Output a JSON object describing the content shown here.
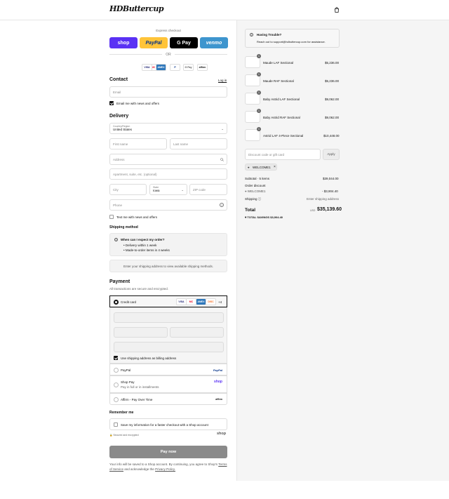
{
  "header": {
    "logo": "HDButtercup"
  },
  "express": {
    "label": "Express checkout",
    "or": "OR",
    "buttons": [
      {
        "label": "shop",
        "bg": "#5a31f4",
        "color": "#fff"
      },
      {
        "label": "PayPal",
        "bg": "#ffc439",
        "color": "#003087"
      },
      {
        "label": "G Pay",
        "bg": "#000",
        "color": "#fff"
      },
      {
        "label": "venmo",
        "bg": "#3d95ce",
        "color": "#fff"
      }
    ],
    "methods": [
      "MC",
      "VISA",
      "AMEX",
      "P",
      "G Pay",
      "affirm"
    ]
  },
  "contact": {
    "title": "Contact",
    "login": "Log in",
    "email_placeholder": "Email",
    "news": "Email me with news and offers"
  },
  "delivery": {
    "title": "Delivery",
    "country_label": "Country/Region",
    "country": "United States",
    "first": "First name",
    "last": "Last name",
    "address": "Address",
    "apt": "Apartment, suite, etc. (optional)",
    "city": "City",
    "state_label": "State",
    "state": "Iowa",
    "zip": "ZIP code",
    "phone": "Phone",
    "text_news": "Text me with news and offers"
  },
  "shipping": {
    "title": "Shipping method",
    "q": "When can I expect my order?",
    "bullets": [
      "Delivery within 1 week",
      "Made-to-order items in 4 weeks"
    ],
    "note": "Enter your shipping address to view available shipping methods."
  },
  "payment": {
    "title": "Payment",
    "sub": "All transactions are secure and encrypted.",
    "credit": "Credit card",
    "cards": [
      "VISA",
      "MC",
      "AMEX",
      "DISC",
      "+4"
    ],
    "billing": "Use shipping address as billing address",
    "paypal": "PayPal",
    "paypal_logo": "PayPal",
    "shoppay": "Shop Pay",
    "shoppay_sub": "Pay in full or in installments",
    "shoppay_logo": "shop",
    "affirm": "Affirm - Pay Over Time",
    "affirm_logo": "affirm"
  },
  "remember": {
    "title": "Remember me",
    "save": "Save my information for a faster checkout with a Shop account",
    "secure": "Secured and encrypted",
    "shop": "shop"
  },
  "paynow": "Pay now",
  "legal": {
    "text": "Your info will be saved to a Shop account. By continuing, you agree to Shop's",
    "tos": "Terms of Service",
    "and": "and acknowledge the",
    "privacy": "Privacy Policy."
  },
  "trouble": {
    "title": "Having Trouble?",
    "text": "Reach out to support@hdbuttercup.com for assistance."
  },
  "items": [
    {
      "qty": "1",
      "name": "Maude LAF Sectional",
      "price": "$5,236.00"
    },
    {
      "qty": "1",
      "name": "Maude RAF Sectional",
      "price": "$5,236.00"
    },
    {
      "qty": "1",
      "name": "Baby Astrid LAF Sectional",
      "price": "$9,062.00"
    },
    {
      "qty": "1",
      "name": "Baby Astrid RAF Sectional",
      "price": "$9,062.00"
    },
    {
      "qty": "1",
      "name": "Astrid LAF 4-Piece Sectional",
      "price": "$10,448.00"
    }
  ],
  "discount": {
    "placeholder": "Discount code or gift card",
    "apply": "Apply",
    "tag": "WELCOME1"
  },
  "summary": {
    "subtotal_label": "Subtotal · 5 items",
    "subtotal": "$39,044.00",
    "order_discount": "Order discount",
    "code": "WELCOME1",
    "discount": "- $3,904.40",
    "shipping_label": "Shipping",
    "shipping": "Enter shipping address",
    "total_label": "Total",
    "currency": "USD",
    "total": "$35,139.60",
    "savings_label": "TOTAL SAVINGS",
    "savings": "$3,904.40"
  }
}
